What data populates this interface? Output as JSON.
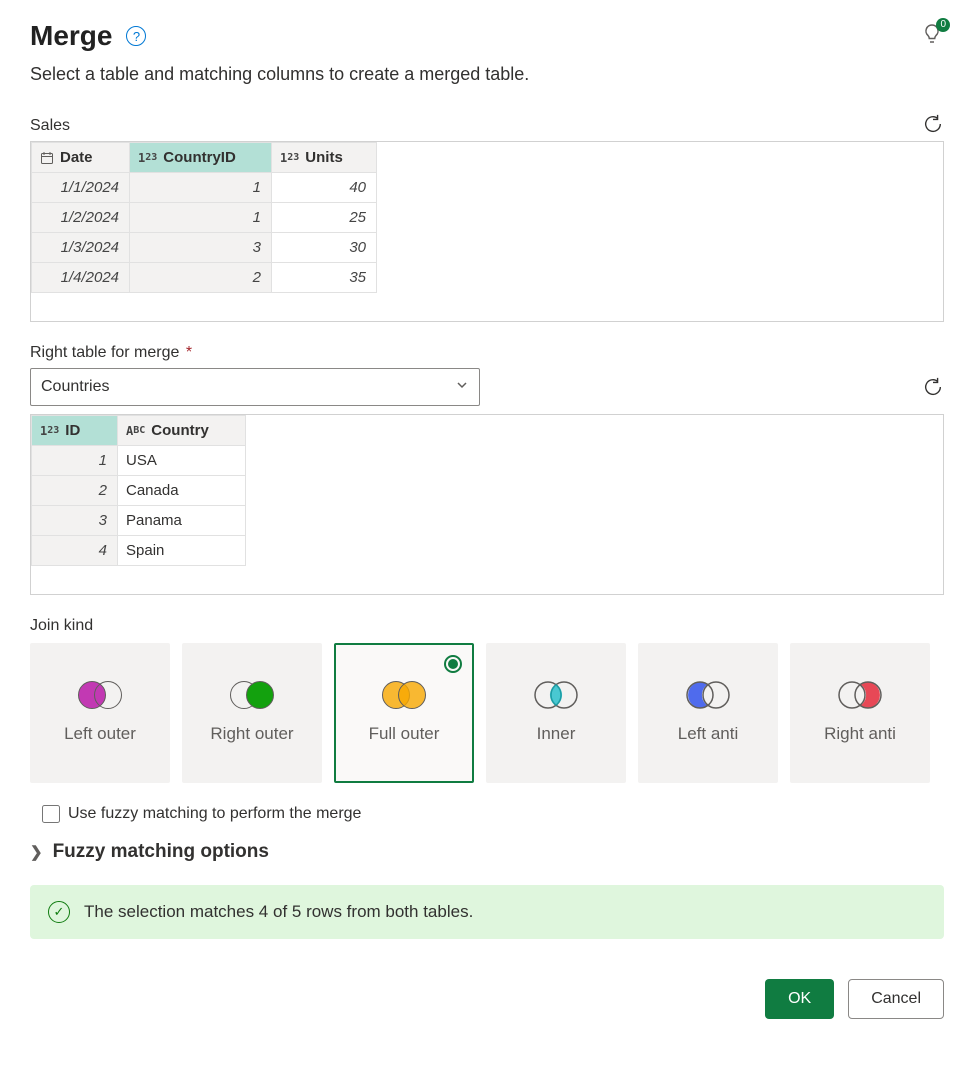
{
  "header": {
    "title": "Merge",
    "tips_badge": "0",
    "subtitle": "Select a table and matching columns to create a merged table."
  },
  "left_table": {
    "name": "Sales",
    "columns": [
      {
        "label": "Date",
        "type_icon": "calendar",
        "selected": false
      },
      {
        "label": "CountryID",
        "type_icon": "number",
        "selected": true
      },
      {
        "label": "Units",
        "type_icon": "number",
        "selected": false
      }
    ],
    "rows": [
      {
        "Date": "1/1/2024",
        "CountryID": "1",
        "Units": "40"
      },
      {
        "Date": "1/2/2024",
        "CountryID": "1",
        "Units": "25"
      },
      {
        "Date": "1/3/2024",
        "CountryID": "3",
        "Units": "30"
      },
      {
        "Date": "1/4/2024",
        "CountryID": "2",
        "Units": "35"
      }
    ]
  },
  "right_section": {
    "label": "Right table for merge",
    "selected_table": "Countries"
  },
  "right_table": {
    "columns": [
      {
        "label": "ID",
        "type_icon": "number",
        "selected": true
      },
      {
        "label": "Country",
        "type_icon": "text",
        "selected": false
      }
    ],
    "rows": [
      {
        "ID": "1",
        "Country": "USA"
      },
      {
        "ID": "2",
        "Country": "Canada"
      },
      {
        "ID": "3",
        "Country": "Panama"
      },
      {
        "ID": "4",
        "Country": "Spain"
      }
    ]
  },
  "joinkind": {
    "label": "Join kind",
    "options": [
      {
        "id": "left-outer",
        "label": "Left outer",
        "selected": false
      },
      {
        "id": "right-outer",
        "label": "Right outer",
        "selected": false
      },
      {
        "id": "full-outer",
        "label": "Full outer",
        "selected": true
      },
      {
        "id": "inner",
        "label": "Inner",
        "selected": false
      },
      {
        "id": "left-anti",
        "label": "Left anti",
        "selected": false
      },
      {
        "id": "right-anti",
        "label": "Right anti",
        "selected": false
      }
    ]
  },
  "fuzzy": {
    "checkbox_label": "Use fuzzy matching to perform the merge",
    "expander_label": "Fuzzy matching options"
  },
  "status": {
    "message": "The selection matches 4 of 5 rows from both tables."
  },
  "buttons": {
    "ok": "OK",
    "cancel": "Cancel"
  }
}
